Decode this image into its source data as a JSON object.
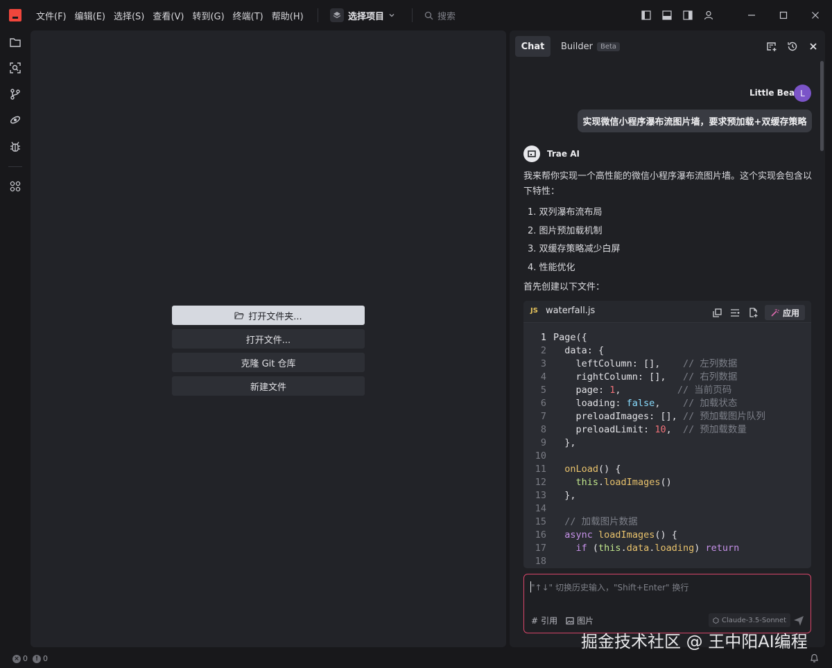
{
  "titlebar": {
    "menu": [
      "文件(F)",
      "编辑(E)",
      "选择(S)",
      "查看(V)",
      "转到(G)",
      "终端(T)",
      "帮助(H)"
    ],
    "project_label": "选择项目",
    "search_placeholder": "搜索"
  },
  "editor": {
    "open_folder": "打开文件夹...",
    "open_file": "打开文件...",
    "clone_repo": "克隆 Git 仓库",
    "new_file": "新建文件"
  },
  "chat": {
    "tab_chat": "Chat",
    "tab_builder": "Builder",
    "builder_badge": "Beta",
    "user": {
      "name": "Little Bear",
      "initial": "L",
      "message": "实现微信小程序瀑布流图片墙，要求预加载+双缓存策略"
    },
    "assistant": {
      "name": "Trae AI",
      "intro": "我来帮你实现一个高性能的微信小程序瀑布流图片墙。这个实现会包含以下特性：",
      "features": [
        "1. 双列瀑布流布局",
        "2. 图片预加载机制",
        "3. 双缓存策略减少白屏",
        "4. 性能优化"
      ],
      "after": "首先创建以下文件："
    },
    "code": {
      "lang_badge": "JS",
      "filename": "waterfall.js",
      "apply_label": "应用",
      "line_numbers": [
        "1",
        "2",
        "3",
        "4",
        "5",
        "6",
        "7",
        "8",
        "9",
        "10",
        "11",
        "12",
        "13",
        "14",
        "15",
        "16",
        "17",
        "18"
      ]
    },
    "input": {
      "placeholder": "\"↑↓\" 切换历史输入，\"Shift+Enter\" 换行",
      "quote_label": "引用",
      "image_label": "图片",
      "model": "Claude-3.5-Sonnet"
    }
  },
  "status": {
    "errors": "0",
    "warnings": "0"
  },
  "watermark": "掘金技术社区 @ 王中阳AI编程",
  "colors": {
    "accent": "#f0463c",
    "avatar": "#7b54c8",
    "input_border": "#d9466a"
  }
}
